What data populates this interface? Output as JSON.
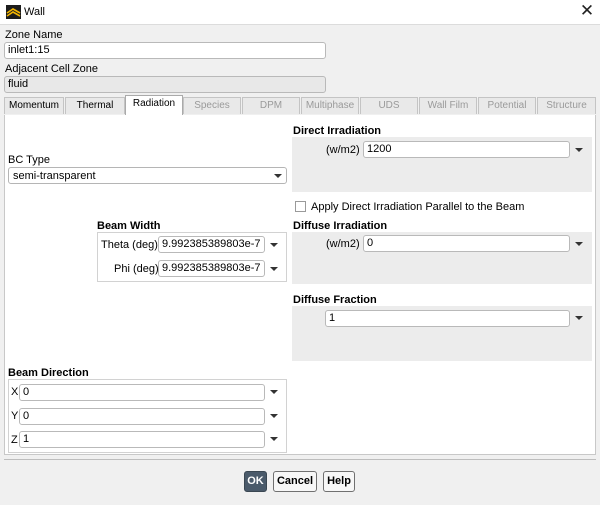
{
  "window": {
    "title": "Wall"
  },
  "zone_name": {
    "label": "Zone Name",
    "value": "inlet1:15"
  },
  "adjacent_cell_zone": {
    "label": "Adjacent Cell Zone",
    "value": "fluid"
  },
  "tabs": [
    {
      "label": "Momentum",
      "state": "enabled"
    },
    {
      "label": "Thermal",
      "state": "enabled"
    },
    {
      "label": "Radiation",
      "state": "active"
    },
    {
      "label": "Species",
      "state": "disabled"
    },
    {
      "label": "DPM",
      "state": "disabled"
    },
    {
      "label": "Multiphase",
      "state": "disabled"
    },
    {
      "label": "UDS",
      "state": "disabled"
    },
    {
      "label": "Wall Film",
      "state": "disabled"
    },
    {
      "label": "Potential",
      "state": "disabled"
    },
    {
      "label": "Structure",
      "state": "disabled"
    }
  ],
  "bc_type": {
    "label": "BC Type",
    "value": "semi-transparent"
  },
  "beam_width": {
    "label": "Beam Width",
    "theta": {
      "label": "Theta (deg)",
      "value": "9.992385389803e-7"
    },
    "phi": {
      "label": "Phi (deg)",
      "value": "9.992385389803e-7"
    }
  },
  "beam_direction": {
    "label": "Beam Direction",
    "x": {
      "label": "X",
      "value": "0"
    },
    "y": {
      "label": "Y",
      "value": "0"
    },
    "z": {
      "label": "Z",
      "value": "1"
    }
  },
  "direct_irradiation": {
    "label": "Direct Irradiation",
    "unit": "(w/m2)",
    "value": "1200"
  },
  "apply_parallel": {
    "label": "Apply Direct Irradiation Parallel to the Beam",
    "checked": false
  },
  "diffuse_irradiation": {
    "label": "Diffuse Irradiation",
    "unit": "(w/m2)",
    "value": "0"
  },
  "diffuse_fraction": {
    "label": "Diffuse Fraction",
    "value": "1"
  },
  "buttons": {
    "ok": "OK",
    "cancel": "Cancel",
    "help": "Help"
  }
}
